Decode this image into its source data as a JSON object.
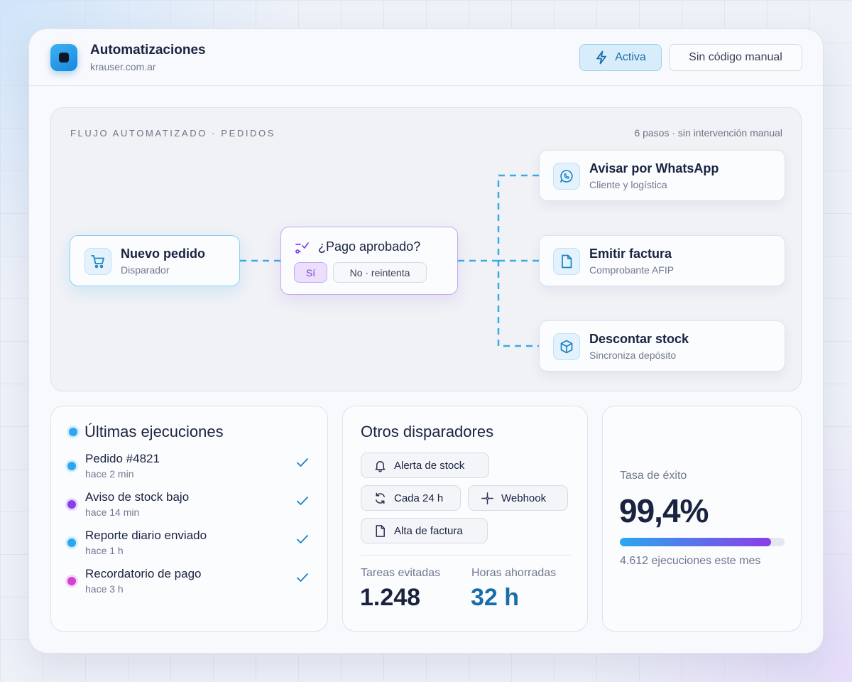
{
  "header": {
    "title": "Automatizaciones",
    "domain": "krauser.com.ar",
    "active_button": "Activa",
    "manual_button": "Sin código manual"
  },
  "flow": {
    "label": "FLUJO AUTOMATIZADO · PEDIDOS",
    "meta": "6 pasos · sin intervención manual",
    "trigger": {
      "title": "Nuevo pedido",
      "subtitle": "Disparador",
      "icon": "cart-icon"
    },
    "decision": {
      "title": "¿Pago aprobado?",
      "yes": "Sí",
      "no": "No · reintenta",
      "icon": "branch-icon"
    },
    "actions": [
      {
        "title": "Avisar por WhatsApp",
        "subtitle": "Cliente y logística",
        "icon": "whatsapp-icon"
      },
      {
        "title": "Emitir factura",
        "subtitle": "Comprobante AFIP",
        "icon": "document-icon"
      },
      {
        "title": "Descontar stock",
        "subtitle": "Sincroniza depósito",
        "icon": "box-icon"
      }
    ]
  },
  "runs": {
    "heading": "Últimas ejecuciones",
    "items": [
      {
        "title": "Pedido #4821",
        "time": "hace 2 min",
        "color": "#2aa7ee"
      },
      {
        "title": "Aviso de stock bajo",
        "time": "hace 14 min",
        "color": "#8a3ee8"
      },
      {
        "title": "Reporte diario enviado",
        "time": "hace 1 h",
        "color": "#2aa7ee"
      },
      {
        "title": "Recordatorio de pago",
        "time": "hace 3 h",
        "color": "#d43fd4"
      }
    ]
  },
  "triggers": {
    "heading": "Otros disparadores",
    "chips": [
      {
        "label": "Alerta de stock",
        "icon": "bell-icon"
      },
      {
        "label": "Cada 24 h",
        "icon": "refresh-icon"
      },
      {
        "label": "Webhook",
        "icon": "webhook-icon"
      },
      {
        "label": "Alta de factura",
        "icon": "document-icon"
      }
    ],
    "stats": [
      {
        "label": "Tareas evitadas",
        "value": "1.248"
      },
      {
        "label": "Horas ahorradas",
        "value": "32 h"
      }
    ]
  },
  "rate": {
    "label": "Tasa de éxito",
    "value": "99,4%",
    "fraction": 0.92,
    "subtitle": "4.612 ejecuciones este mes"
  },
  "colors": {
    "accent_blue": "#2aa7ee",
    "accent_purple": "#8a3ee8",
    "text_dark": "#1a2340",
    "stat_blue": "#1a6ea8"
  }
}
